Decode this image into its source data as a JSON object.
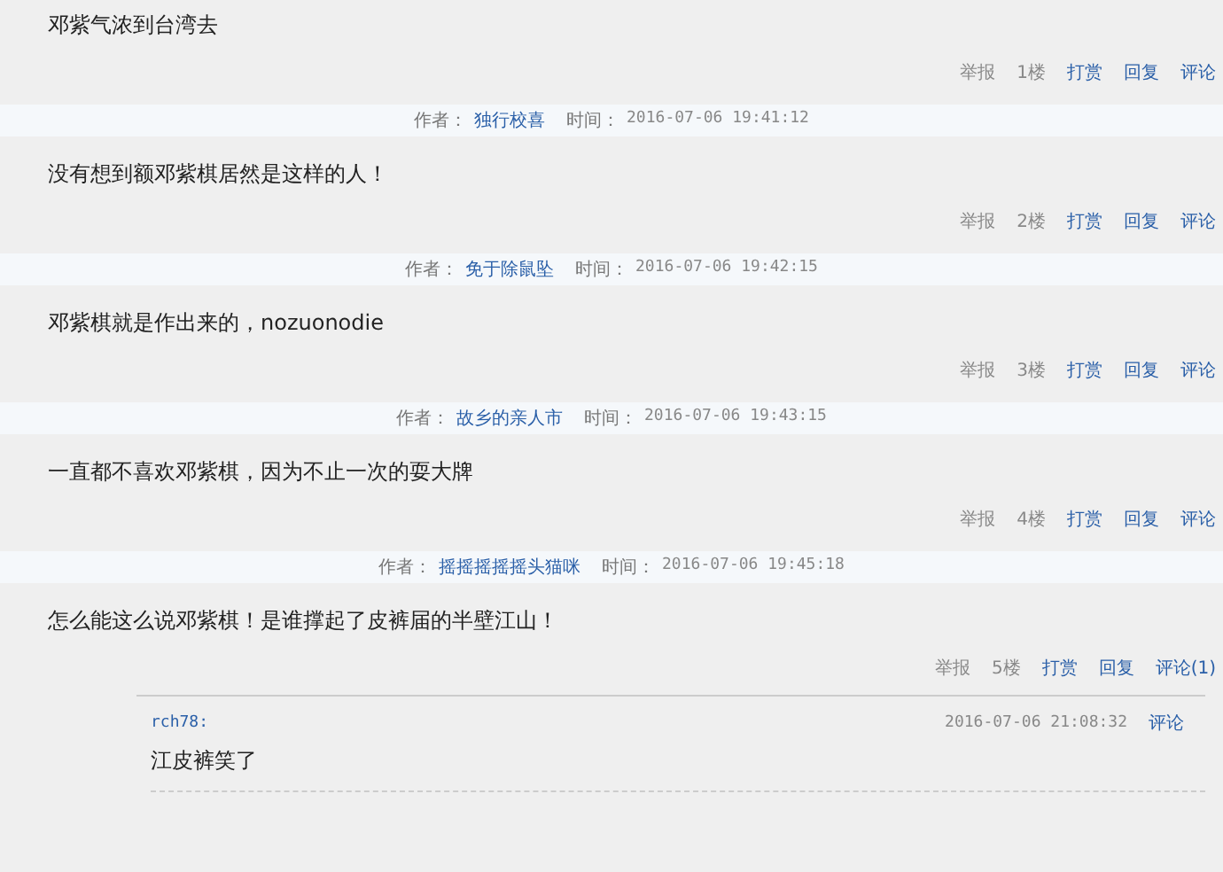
{
  "posts": [
    {
      "body": "邓紫气浓到台湾去",
      "actions": [
        {
          "label": "举报",
          "kind": "plain"
        },
        {
          "label": "1楼",
          "kind": "plain"
        },
        {
          "label": "打赏",
          "kind": "link"
        },
        {
          "label": "回复",
          "kind": "link"
        },
        {
          "label": "评论",
          "kind": "link"
        }
      ]
    },
    {
      "header": {
        "author_label": "作者：",
        "author": "独行校喜",
        "time_label": "时间：",
        "time": "2016-07-06 19:41:12"
      },
      "body": "没有想到额邓紫棋居然是这样的人！",
      "actions": [
        {
          "label": "举报",
          "kind": "plain"
        },
        {
          "label": "2楼",
          "kind": "plain"
        },
        {
          "label": "打赏",
          "kind": "link"
        },
        {
          "label": "回复",
          "kind": "link"
        },
        {
          "label": "评论",
          "kind": "link"
        }
      ]
    },
    {
      "header": {
        "author_label": "作者：",
        "author": "免于除鼠坠",
        "time_label": "时间：",
        "time": "2016-07-06 19:42:15"
      },
      "body": "邓紫棋就是作出来的，nozuonodie",
      "actions": [
        {
          "label": "举报",
          "kind": "plain"
        },
        {
          "label": "3楼",
          "kind": "plain"
        },
        {
          "label": "打赏",
          "kind": "link"
        },
        {
          "label": "回复",
          "kind": "link"
        },
        {
          "label": "评论",
          "kind": "link"
        }
      ]
    },
    {
      "header": {
        "author_label": "作者：",
        "author": "故乡的亲人市",
        "time_label": "时间：",
        "time": "2016-07-06 19:43:15"
      },
      "body": "一直都不喜欢邓紫棋，因为不止一次的耍大牌",
      "actions": [
        {
          "label": "举报",
          "kind": "plain"
        },
        {
          "label": "4楼",
          "kind": "plain"
        },
        {
          "label": "打赏",
          "kind": "link"
        },
        {
          "label": "回复",
          "kind": "link"
        },
        {
          "label": "评论",
          "kind": "link"
        }
      ]
    },
    {
      "header": {
        "author_label": "作者：",
        "author": "摇摇摇摇摇头猫咪",
        "time_label": "时间：",
        "time": "2016-07-06 19:45:18"
      },
      "body": "怎么能这么说邓紫棋！是谁撑起了皮裤届的半壁江山！",
      "actions": [
        {
          "label": "举报",
          "kind": "plain"
        },
        {
          "label": "5楼",
          "kind": "plain"
        },
        {
          "label": "打赏",
          "kind": "link"
        },
        {
          "label": "回复",
          "kind": "link"
        },
        {
          "label": "评论(1)",
          "kind": "link"
        }
      ],
      "comments": [
        {
          "user": "rch78:",
          "time": "2016-07-06 21:08:32",
          "action": "评论",
          "text": "江皮裤笑了"
        }
      ]
    }
  ]
}
